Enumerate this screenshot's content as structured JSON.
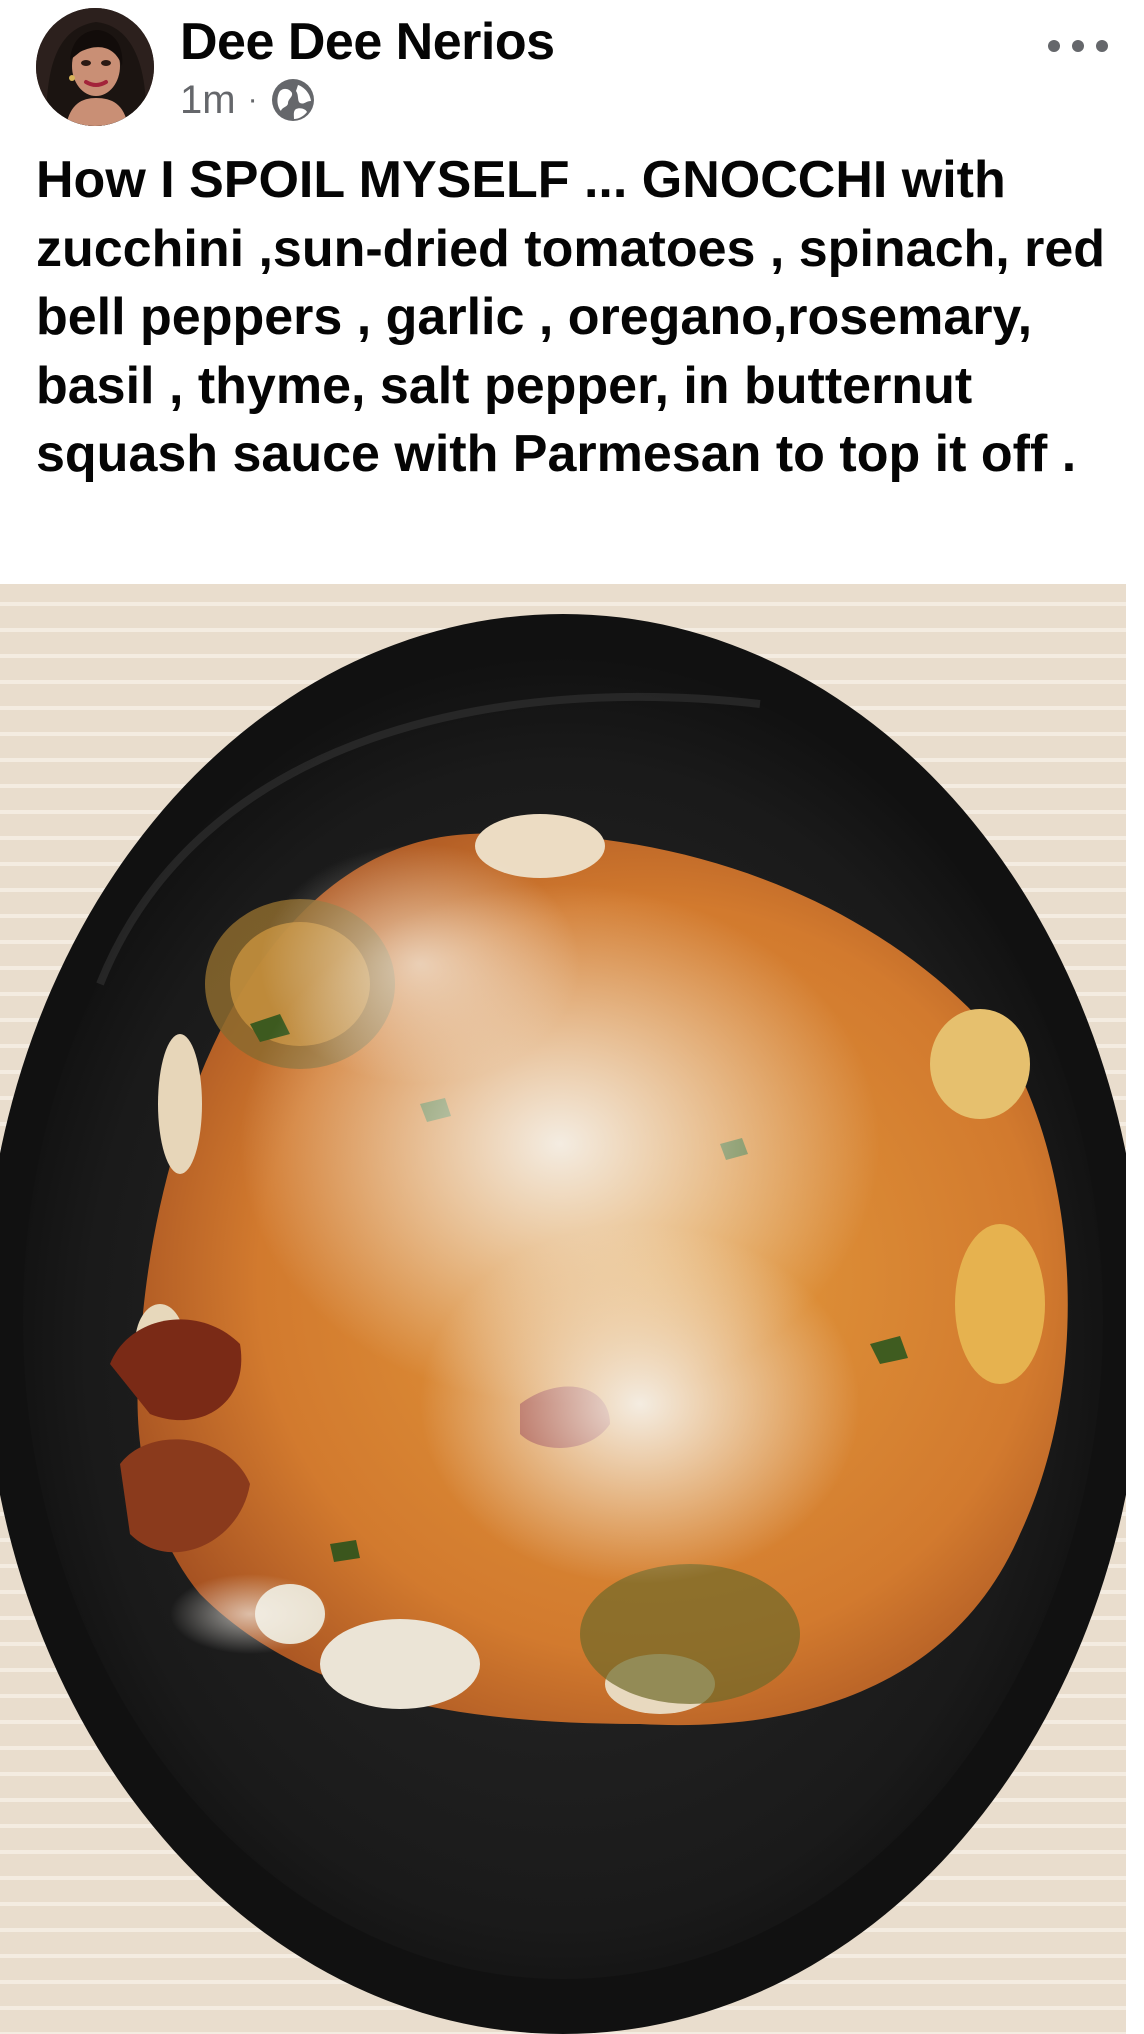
{
  "post": {
    "author_name": "Dee Dee Nerios",
    "timestamp": "1m",
    "separator": "·",
    "audience_icon": "globe-icon",
    "more_icon": "more-horizontal-icon",
    "caption": "How I SPOIL MYSELF ... GNOCCHI with zucchini ,sun-dried tomatoes , spinach, red bell peppers , garlic , oregano,rosemary, basil , thyme, salt pepper, in butternut squash sauce with Parmesan to top it off ."
  },
  "colors": {
    "text_primary": "#050505",
    "text_secondary": "#65676b",
    "background": "#ffffff"
  }
}
